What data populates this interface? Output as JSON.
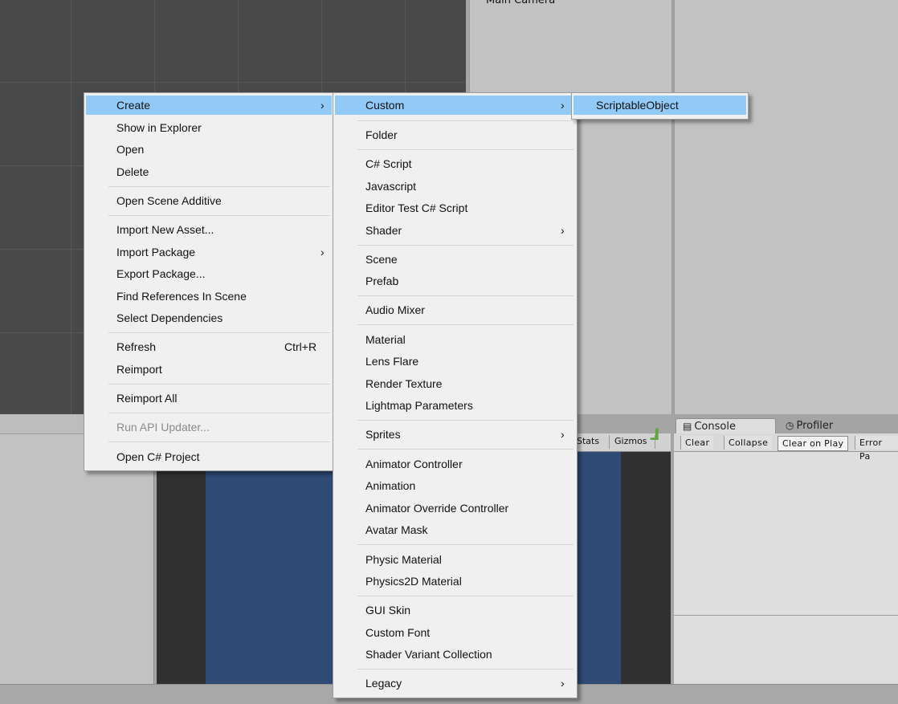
{
  "hierarchy": {
    "item": "Main Camera"
  },
  "game_toolbar": {
    "stats": "Stats",
    "gizmos": "Gizmos"
  },
  "console": {
    "tabs": [
      {
        "label": "Console",
        "icon": "console-icon"
      },
      {
        "label": "Profiler",
        "icon": "profiler-icon"
      }
    ],
    "toolbar": [
      "Clear",
      "Collapse",
      "Clear on Play",
      "Error Pa"
    ]
  },
  "context_menu": {
    "items": [
      {
        "label": "Create",
        "submenu": true,
        "highlighted": true
      },
      {
        "label": "Show in Explorer"
      },
      {
        "label": "Open"
      },
      {
        "label": "Delete"
      },
      {
        "label": "Open Scene Additive"
      },
      {
        "label": "Import New Asset..."
      },
      {
        "label": "Import Package",
        "submenu": true
      },
      {
        "label": "Export Package..."
      },
      {
        "label": "Find References In Scene"
      },
      {
        "label": "Select Dependencies"
      },
      {
        "label": "Refresh",
        "shortcut": "Ctrl+R"
      },
      {
        "label": "Reimport"
      },
      {
        "label": "Reimport All"
      },
      {
        "label": "Run API Updater...",
        "disabled": true
      },
      {
        "label": "Open C# Project"
      }
    ]
  },
  "create_menu": {
    "items": [
      {
        "label": "Custom",
        "submenu": true,
        "highlighted": true
      },
      {
        "label": "Folder"
      },
      {
        "label": "C# Script"
      },
      {
        "label": "Javascript"
      },
      {
        "label": "Editor Test C# Script"
      },
      {
        "label": "Shader",
        "submenu": true
      },
      {
        "label": "Scene"
      },
      {
        "label": "Prefab"
      },
      {
        "label": "Audio Mixer"
      },
      {
        "label": "Material"
      },
      {
        "label": "Lens Flare"
      },
      {
        "label": "Render Texture"
      },
      {
        "label": "Lightmap Parameters"
      },
      {
        "label": "Sprites",
        "submenu": true
      },
      {
        "label": "Animator Controller"
      },
      {
        "label": "Animation"
      },
      {
        "label": "Animator Override Controller"
      },
      {
        "label": "Avatar Mask"
      },
      {
        "label": "Physic Material"
      },
      {
        "label": "Physics2D Material"
      },
      {
        "label": "GUI Skin"
      },
      {
        "label": "Custom Font"
      },
      {
        "label": "Shader Variant Collection"
      },
      {
        "label": "Legacy",
        "submenu": true
      }
    ]
  },
  "custom_menu": {
    "items": [
      {
        "label": "ScriptableObject",
        "highlighted": true
      }
    ]
  },
  "glyphs": {
    "submenu_arrow": "›",
    "grid_icon": "ᒧ"
  },
  "colors": {
    "highlight": "#91c9f7",
    "scene_bg": "#484848",
    "game_bg": "#2e4a75"
  }
}
